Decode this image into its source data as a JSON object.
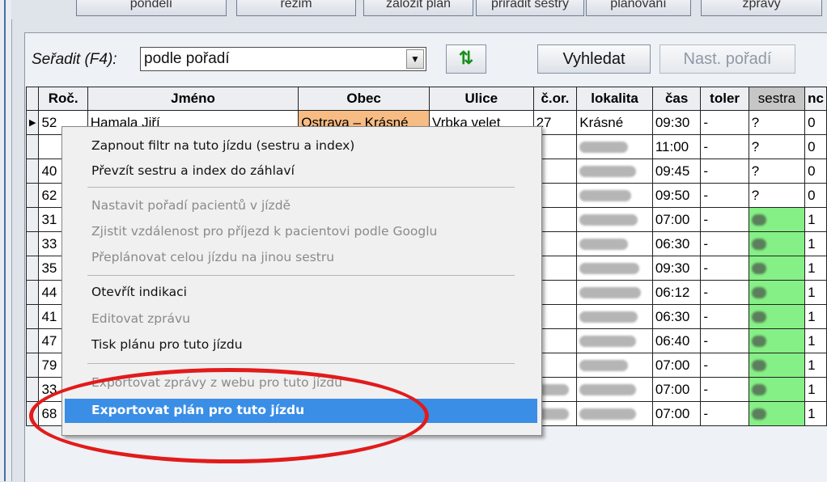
{
  "top_tabs": [
    "pondělí",
    "režim",
    "založit plán",
    "přiřadit sestry",
    "plánování",
    "zprávy"
  ],
  "toolbar": {
    "sort_label": "Seřadit (F4):",
    "sort_value": "podle pořadí",
    "refresh_icon": "refresh-arrows-icon",
    "search_label": "Vyhledat",
    "order_label": "Nast. pořadí"
  },
  "columns": [
    "Roč.",
    "Jméno",
    "Obec",
    "Ulice",
    "č.or.",
    "lokalita",
    "čas",
    "toler",
    "sestra",
    "nc"
  ],
  "rows": [
    {
      "roc": "52",
      "jmeno": "Hamala Jiří",
      "obec": "Ostrava – Krásné",
      "ulice": "Vrbka velet",
      "cor": "27",
      "lokalita": "Krásné",
      "cas": "09:30",
      "toler": "-",
      "sestra": "?",
      "nc": "0"
    },
    {
      "roc": "",
      "cas": "11:00",
      "toler": "-",
      "sestra": "?",
      "nc": "0"
    },
    {
      "roc": "40",
      "cas": "09:45",
      "toler": "-",
      "sestra": "?",
      "nc": "0"
    },
    {
      "roc": "62",
      "cas": "09:50",
      "toler": "-",
      "sestra": "?",
      "nc": "0"
    },
    {
      "roc": "31",
      "cas": "07:00",
      "toler": "-",
      "sestra": "",
      "nc": "1"
    },
    {
      "roc": "33",
      "cas": "06:30",
      "toler": "-",
      "sestra": "",
      "nc": "1"
    },
    {
      "roc": "35",
      "cas": "09:30",
      "toler": "-",
      "sestra": "",
      "nc": "1"
    },
    {
      "roc": "44",
      "cas": "06:12",
      "toler": "-",
      "sestra": "",
      "nc": "1"
    },
    {
      "roc": "41",
      "cas": "06:30",
      "toler": "-",
      "sestra": "",
      "nc": "1"
    },
    {
      "roc": "47",
      "cas": "06:40",
      "toler": "-",
      "sestra": "",
      "nc": "1"
    },
    {
      "roc": "79",
      "cas": "07:00",
      "toler": "-",
      "sestra": "",
      "nc": "1"
    },
    {
      "roc": "33",
      "cas": "07:00",
      "toler": "-",
      "sestra": "",
      "nc": "1"
    },
    {
      "roc": "68",
      "cas": "07:00",
      "toler": "-",
      "sestra": "",
      "nc": "1"
    }
  ],
  "context_menu": {
    "items": [
      {
        "label": "Zapnout filtr na tuto jízdu (sestru a index)",
        "enabled": true
      },
      {
        "label": "Převzít sestru a index do záhlaví",
        "enabled": true
      },
      {
        "label": "Nastavit pořadí pacientů v jízdě",
        "enabled": false
      },
      {
        "label": "Zjistit vzdálenost pro příjezd k pacientovi podle Googlu",
        "enabled": false
      },
      {
        "label": "Přeplánovat celou jízdu na jinou sestru",
        "enabled": false
      },
      {
        "label": "Otevřít indikaci",
        "enabled": true
      },
      {
        "label": "Editovat zprávu",
        "enabled": false
      },
      {
        "label": "Tisk plánu pro tuto jízdu",
        "enabled": true
      },
      {
        "label": "Exportovat zprávy z webu pro tuto jízdu",
        "enabled": false
      },
      {
        "label": "Exportovat plán pro tuto jízdu",
        "enabled": true,
        "highlighted": true
      }
    ]
  },
  "colors": {
    "nurse_green": "#85f085",
    "obec_highlight": "#f7bc84",
    "menu_highlight": "#3a8ee6",
    "annotation_red": "#e21b1b"
  }
}
